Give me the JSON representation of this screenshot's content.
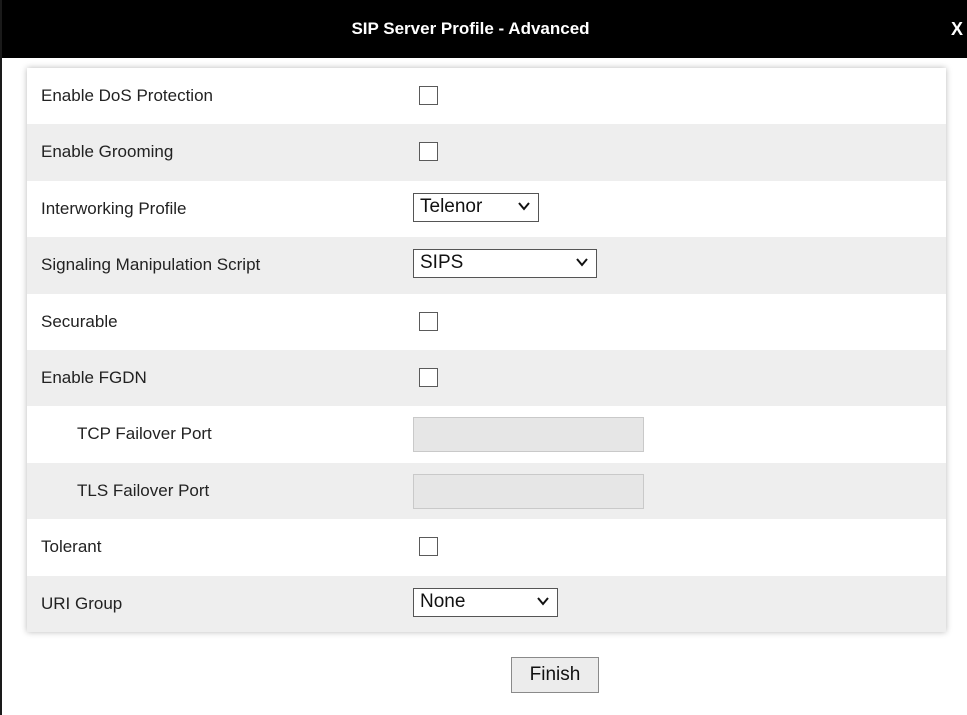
{
  "dialog": {
    "title": "SIP Server Profile - Advanced",
    "close_label": "X"
  },
  "form": {
    "rows": [
      {
        "label": "Enable DoS Protection",
        "control": "checkbox",
        "checked": false
      },
      {
        "label": "Enable Grooming",
        "control": "checkbox",
        "checked": false
      },
      {
        "label": "Interworking Profile",
        "control": "select",
        "value": "Telenor"
      },
      {
        "label": "Signaling Manipulation Script",
        "control": "select",
        "value": "SIPS"
      },
      {
        "label": "Securable",
        "control": "checkbox",
        "checked": false
      },
      {
        "label": "Enable FGDN",
        "control": "checkbox",
        "checked": false
      },
      {
        "label": "TCP Failover Port",
        "control": "text",
        "value": "",
        "disabled": true
      },
      {
        "label": "TLS Failover Port",
        "control": "text",
        "value": "",
        "disabled": true
      },
      {
        "label": "Tolerant",
        "control": "checkbox",
        "checked": false
      },
      {
        "label": "URI Group",
        "control": "select",
        "value": "None"
      }
    ]
  },
  "footer": {
    "finish_label": "Finish"
  },
  "icons": {
    "close": "close-icon",
    "dropdown": "chevron-down-icon"
  },
  "colors": {
    "titlebar_bg": "#000000",
    "titlebar_text": "#ffffff",
    "row_shade": "#eeeeee",
    "disabled_field": "#e6e6e6"
  }
}
